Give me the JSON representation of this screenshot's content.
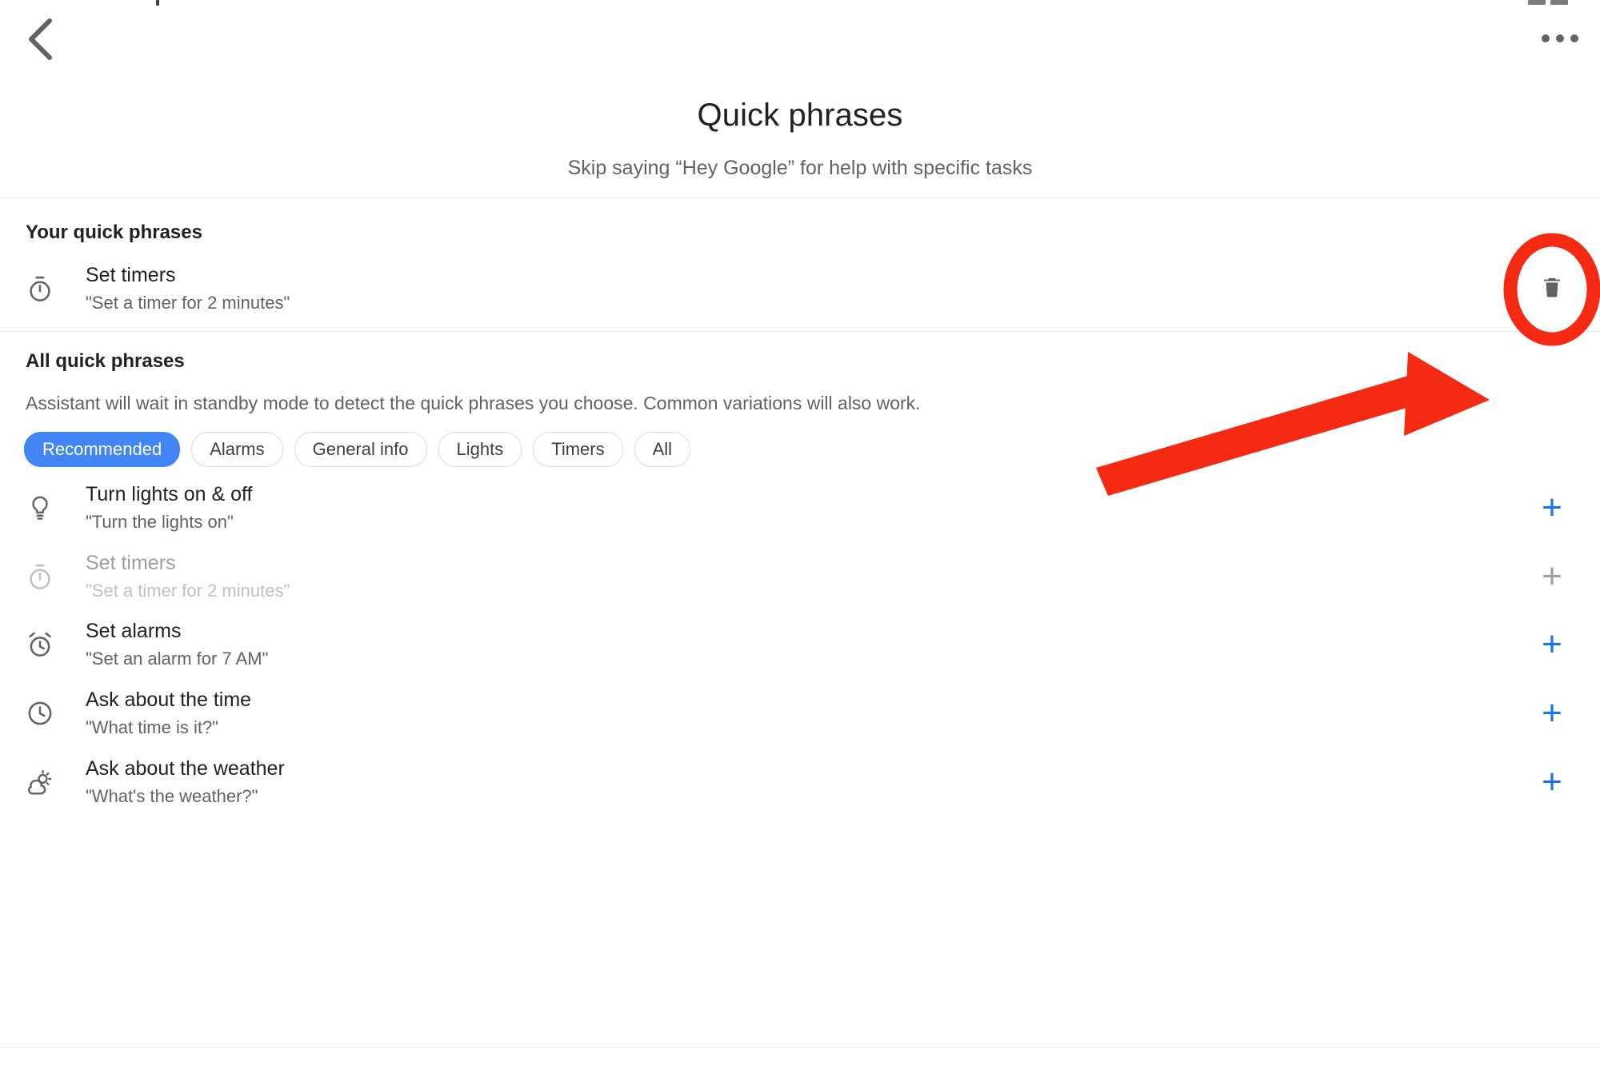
{
  "header": {
    "back_icon": "chevron-left-icon",
    "overflow_icon": "more-options-icon",
    "title": "Quick phrases",
    "subtitle": "Skip saying “Hey Google” for help with specific tasks"
  },
  "your_section": {
    "heading": "Your quick phrases",
    "items": [
      {
        "icon": "stopwatch-icon",
        "title": "Set timers",
        "example": "\"Set a timer for 2 minutes\"",
        "action_icon": "trash-icon",
        "disabled": false
      }
    ]
  },
  "all_section": {
    "heading": "All quick phrases",
    "description": "Assistant will wait in standby mode to detect the quick phrases you choose. Common variations will also work.",
    "filters": [
      {
        "label": "Recommended",
        "active": true
      },
      {
        "label": "Alarms",
        "active": false
      },
      {
        "label": "General info",
        "active": false
      },
      {
        "label": "Lights",
        "active": false
      },
      {
        "label": "Timers",
        "active": false
      },
      {
        "label": "All",
        "active": false
      }
    ],
    "items": [
      {
        "icon": "lightbulb-icon",
        "title": "Turn lights on & off",
        "example": "\"Turn the lights on\"",
        "action_icon": "plus-icon",
        "action_label": "+",
        "disabled": false
      },
      {
        "icon": "stopwatch-icon",
        "title": "Set timers",
        "example": "\"Set a timer for 2 minutes\"",
        "action_icon": "plus-icon",
        "action_label": "+",
        "disabled": true
      },
      {
        "icon": "alarm-clock-icon",
        "title": "Set alarms",
        "example": "\"Set an alarm for 7 AM\"",
        "action_icon": "plus-icon",
        "action_label": "+",
        "disabled": false
      },
      {
        "icon": "clock-icon",
        "title": "Ask about the time",
        "example": "\"What time is it?\"",
        "action_icon": "plus-icon",
        "action_label": "+",
        "disabled": false
      },
      {
        "icon": "weather-icon",
        "title": "Ask about the weather",
        "example": "\"What's the weather?\"",
        "action_icon": "plus-icon",
        "action_label": "+",
        "disabled": false
      }
    ]
  },
  "annotation": {
    "color": "#F42A12",
    "arrow_name": "red-arrow-pointer",
    "highlight_name": "red-ellipse-highlight"
  },
  "colors": {
    "accent_blue": "#4285F4",
    "link_blue": "#1A73E8",
    "text_primary": "#202124",
    "text_secondary": "#5F6368",
    "text_disabled": "#9AA0A6",
    "divider": "#E8EAED",
    "annotation_red": "#F42A12"
  }
}
